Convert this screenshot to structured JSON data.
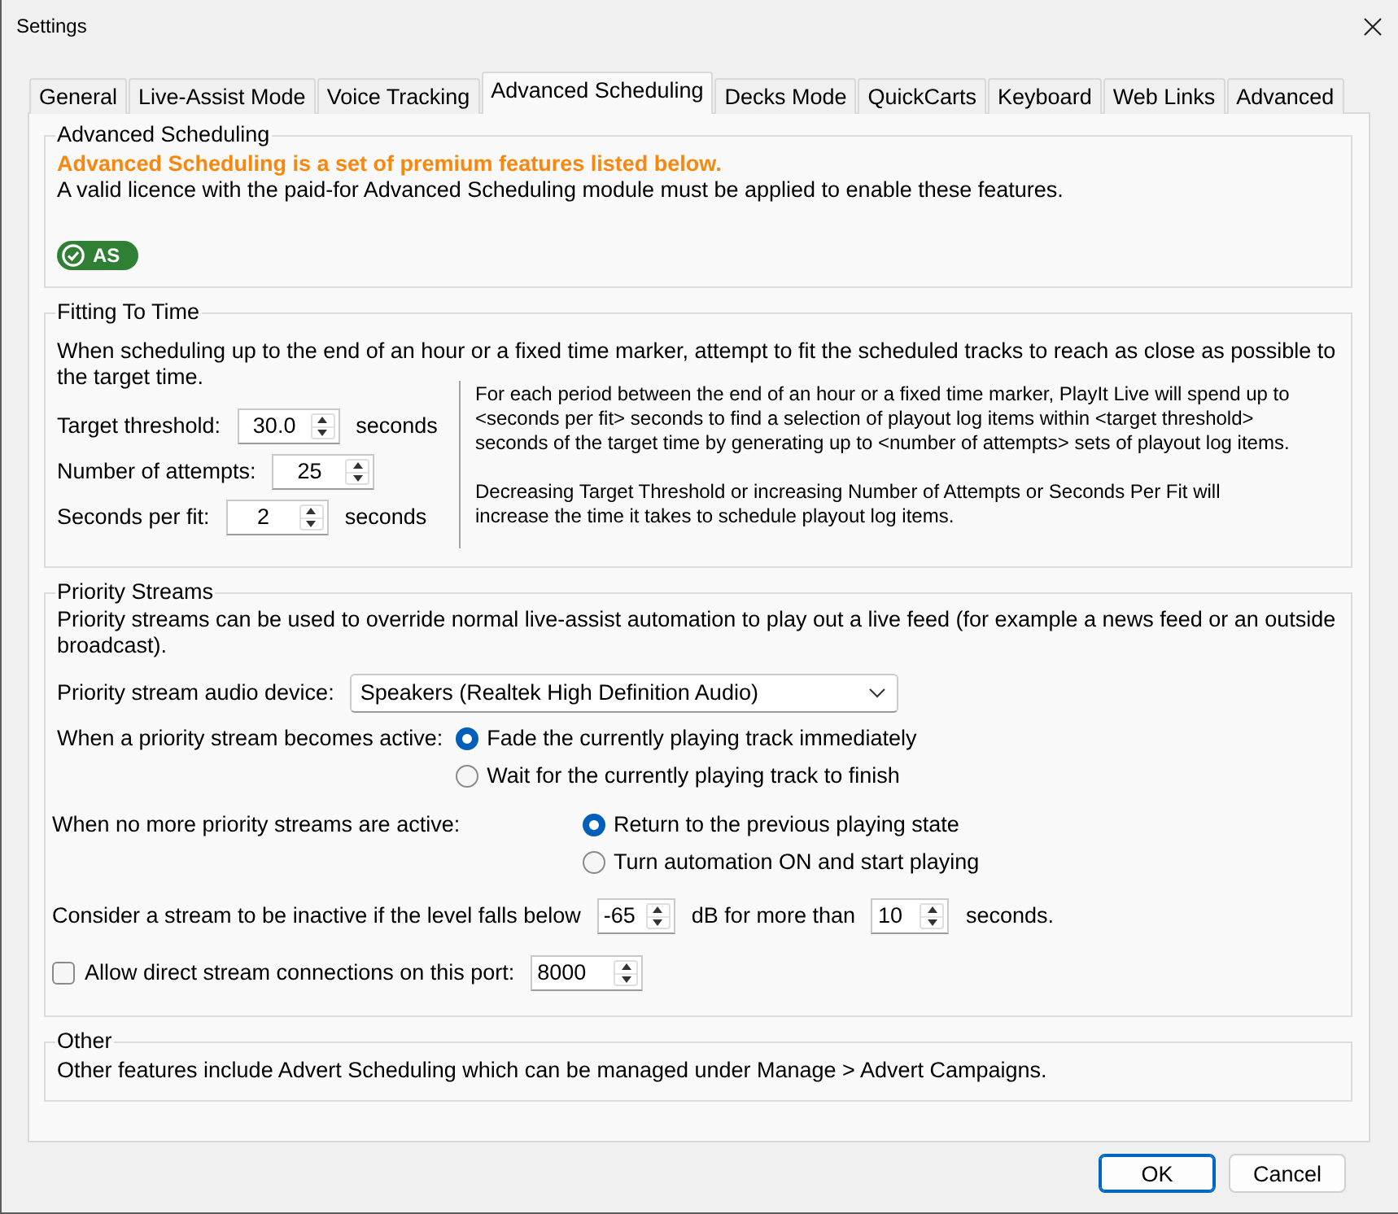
{
  "window": {
    "title": "Settings"
  },
  "tabs": [
    {
      "label": "General",
      "selected": false
    },
    {
      "label": "Live-Assist Mode",
      "selected": false
    },
    {
      "label": "Voice Tracking",
      "selected": false
    },
    {
      "label": "Advanced Scheduling",
      "selected": true
    },
    {
      "label": "Decks Mode",
      "selected": false
    },
    {
      "label": "QuickCarts",
      "selected": false
    },
    {
      "label": "Keyboard",
      "selected": false
    },
    {
      "label": "Web Links",
      "selected": false
    },
    {
      "label": "Advanced",
      "selected": false
    }
  ],
  "advanced_scheduling": {
    "title": "Advanced Scheduling",
    "headline": "Advanced Scheduling is a set of premium features listed below.",
    "description": "A valid licence with the paid-for Advanced Scheduling module must be applied to enable these features.",
    "badge": {
      "label": "AS"
    }
  },
  "fitting_to_time": {
    "title": "Fitting To Time",
    "description": "When scheduling up to the end of an hour or a fixed time marker, attempt to fit the scheduled tracks to reach as close as possible to the target time.",
    "fields": [
      {
        "label": "Target threshold:",
        "value": "30.0",
        "unit": "seconds"
      },
      {
        "label": "Number of attempts:",
        "value": "25"
      },
      {
        "label": "Seconds per fit:",
        "value": "2",
        "unit": "seconds"
      }
    ],
    "notes": [
      "For each period between the end of an hour or a fixed time marker, PlayIt Live will spend up to <seconds per fit> seconds to find a selection of playout log items within <target threshold> seconds of the target time by generating up to <number of attempts> sets of playout log items.",
      "Decreasing Target Threshold or increasing Number of Attempts or Seconds Per Fit will increase the time it takes to schedule playout log items."
    ]
  },
  "priority_streams": {
    "title": "Priority Streams",
    "description": "Priority streams can be used to override normal live-assist automation to play out a live feed (for example a news feed or an outside broadcast).",
    "device": {
      "label": "Priority stream audio device:",
      "value": "Speakers (Realtek High Definition Audio)"
    },
    "choices": [
      {
        "label": "When a priority stream becomes active:",
        "options": [
          {
            "label": "Fade the currently playing track immediately",
            "selected": true
          },
          {
            "label": "Wait for the currently playing track to finish",
            "selected": false
          }
        ]
      },
      {
        "label": "When no more priority streams are active:",
        "options": [
          {
            "label": "Return to the previous playing state",
            "selected": true
          },
          {
            "label": "Turn automation ON and start playing",
            "selected": false
          }
        ]
      }
    ],
    "inactivity": [
      {
        "kind": "text",
        "text": "Consider a stream to be inactive if the level falls below"
      },
      {
        "kind": "spin",
        "value": "-65"
      },
      {
        "kind": "text",
        "text": "dB for more than"
      },
      {
        "kind": "spin",
        "value": "10"
      },
      {
        "kind": "text",
        "text": "seconds."
      }
    ],
    "direct_port": {
      "label": "Allow direct stream connections on this port:",
      "checked": false,
      "value": "8000"
    }
  },
  "other": {
    "title": "Other",
    "description": "Other features include Advert Scheduling which can be managed under Manage > Advert Campaigns."
  },
  "buttons": [
    {
      "label": "OK",
      "default": true
    },
    {
      "label": "Cancel",
      "default": false
    }
  ]
}
